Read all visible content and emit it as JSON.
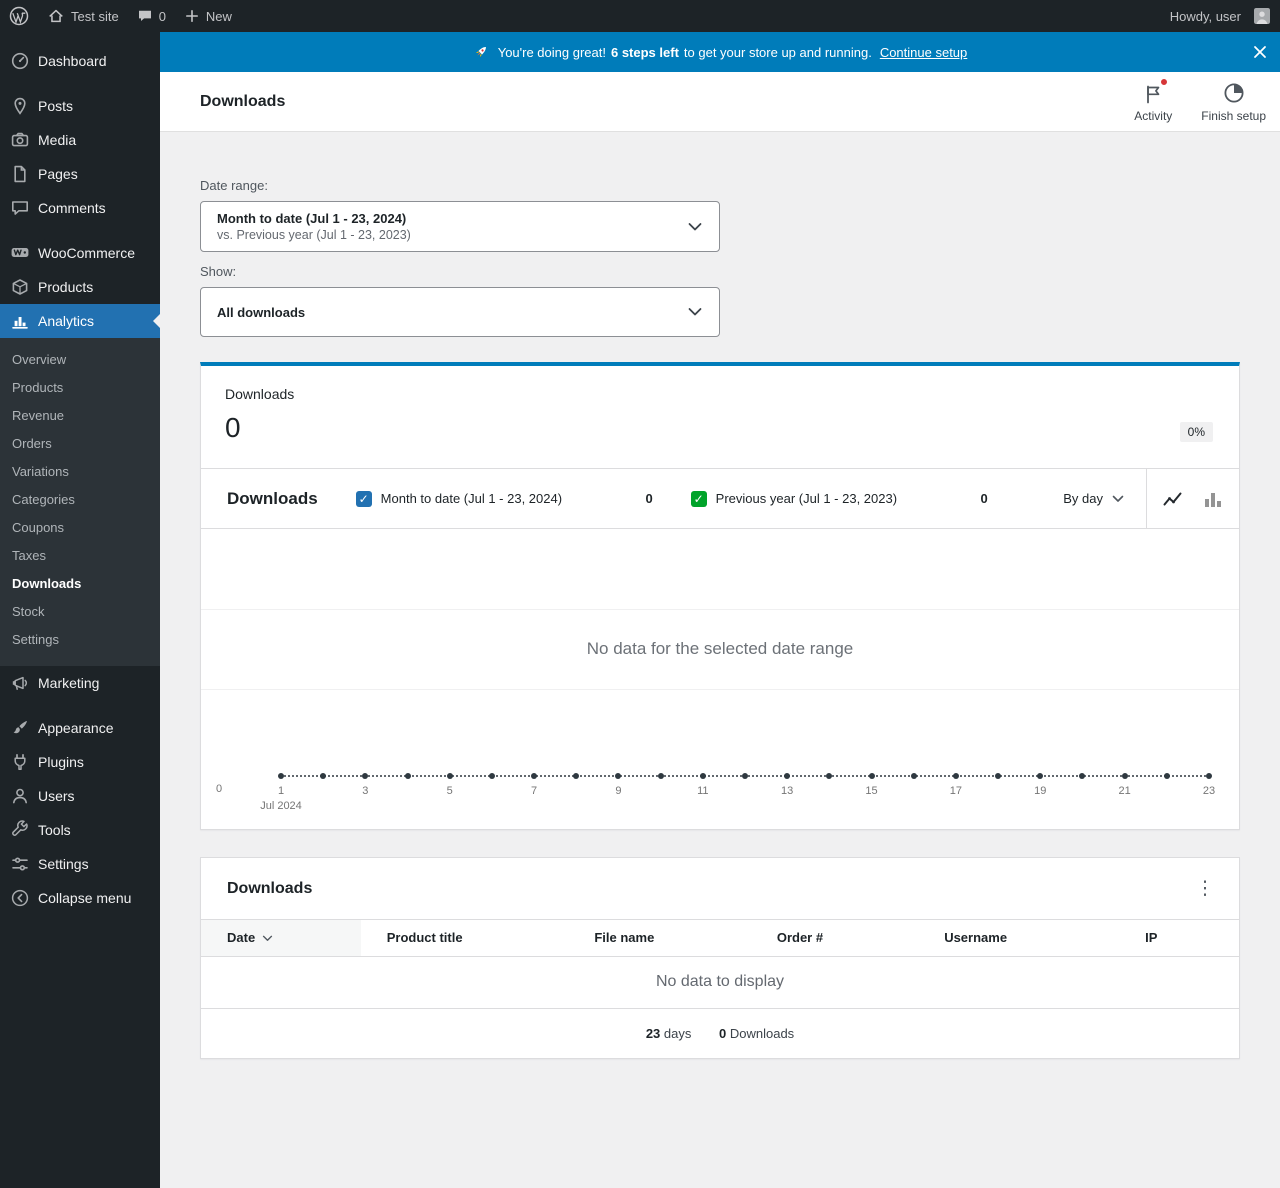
{
  "admin_bar": {
    "wordpress_icon": "wordpress-logo-icon",
    "site_name": "Test site",
    "comment_count": "0",
    "new_label": "New",
    "howdy": "Howdy, user"
  },
  "banner": {
    "emoji": "🚀",
    "icon": "rocket-icon",
    "message_pre": "You're doing great!",
    "steps_highlight": "6 steps left",
    "message_post": "to get your store up and running.",
    "link_label": "Continue setup",
    "background": "#007cba"
  },
  "header": {
    "title": "Downloads",
    "actions": [
      {
        "label": "Activity",
        "icon": "flag-icon",
        "has_unread": true
      },
      {
        "label": "Finish setup",
        "icon": "progress-clock-icon"
      }
    ]
  },
  "filters": {
    "date_range_label": "Date range:",
    "date_range_value": "Month to date (Jul 1 - 23, 2024)",
    "date_range_compare": "vs. Previous year (Jul 1 - 23, 2023)",
    "show_label": "Show:",
    "show_value": "All downloads"
  },
  "summary": {
    "label": "Downloads",
    "value": "0",
    "delta": "0%"
  },
  "chart": {
    "title": "Downloads",
    "legend": [
      {
        "label": "Month to date (Jul 1 - 23, 2024)",
        "value": "0",
        "color": "#2271b1"
      },
      {
        "label": "Previous year (Jul 1 - 23, 2023)",
        "value": "0",
        "color": "#00a32a"
      }
    ],
    "interval_label": "By day",
    "empty_message": "No data for the selected date range",
    "y_zero_label": "0",
    "x_ticks": [
      "1",
      "3",
      "5",
      "7",
      "9",
      "11",
      "13",
      "15",
      "17",
      "19",
      "21",
      "23"
    ],
    "x_period_label": "Jul 2024"
  },
  "chart_data": {
    "type": "line",
    "title": "Downloads",
    "x_unit": "day",
    "x_range": [
      1,
      23
    ],
    "x_period": "Jul 2024",
    "y_baseline": 0,
    "empty": true,
    "series": [
      {
        "name": "Month to date (Jul 1 - 23, 2024)",
        "total": 0,
        "values": []
      },
      {
        "name": "Previous year (Jul 1 - 23, 2023)",
        "total": 0,
        "values": []
      }
    ]
  },
  "table": {
    "title": "Downloads",
    "menu_icon": "kebab-menu-icon",
    "columns": [
      {
        "label": "Date",
        "sorted": "desc"
      },
      {
        "label": "Product title"
      },
      {
        "label": "File name"
      },
      {
        "label": "Order #"
      },
      {
        "label": "Username"
      },
      {
        "label": "IP"
      }
    ],
    "empty_message": "No data to display",
    "summary": [
      {
        "value": "23",
        "label": "days"
      },
      {
        "value": "0",
        "label": "Downloads"
      }
    ]
  },
  "sidebar": {
    "items": [
      {
        "label": "Dashboard",
        "icon": "dashboard-icon"
      },
      {
        "type": "separator"
      },
      {
        "label": "Posts",
        "icon": "pin-icon"
      },
      {
        "label": "Media",
        "icon": "camera-icon"
      },
      {
        "label": "Pages",
        "icon": "document-icon"
      },
      {
        "label": "Comments",
        "icon": "comment-icon"
      },
      {
        "type": "separator"
      },
      {
        "label": "WooCommerce",
        "icon": "woocommerce-icon"
      },
      {
        "label": "Products",
        "icon": "box-icon"
      },
      {
        "label": "Analytics",
        "icon": "bar-chart-icon",
        "active": true,
        "submenu": [
          "Overview",
          "Products",
          "Revenue",
          "Orders",
          "Variations",
          "Categories",
          "Coupons",
          "Taxes",
          "Downloads",
          "Stock",
          "Settings"
        ],
        "current_submenu": "Downloads"
      },
      {
        "label": "Marketing",
        "icon": "megaphone-icon"
      },
      {
        "type": "separator"
      },
      {
        "label": "Appearance",
        "icon": "paintbrush-icon"
      },
      {
        "label": "Plugins",
        "icon": "plug-icon"
      },
      {
        "label": "Users",
        "icon": "user-icon"
      },
      {
        "label": "Tools",
        "icon": "wrench-icon"
      },
      {
        "label": "Settings",
        "icon": "sliders-icon"
      }
    ],
    "collapse_label": "Collapse menu",
    "collapse_icon": "collapse-arrow-icon"
  }
}
